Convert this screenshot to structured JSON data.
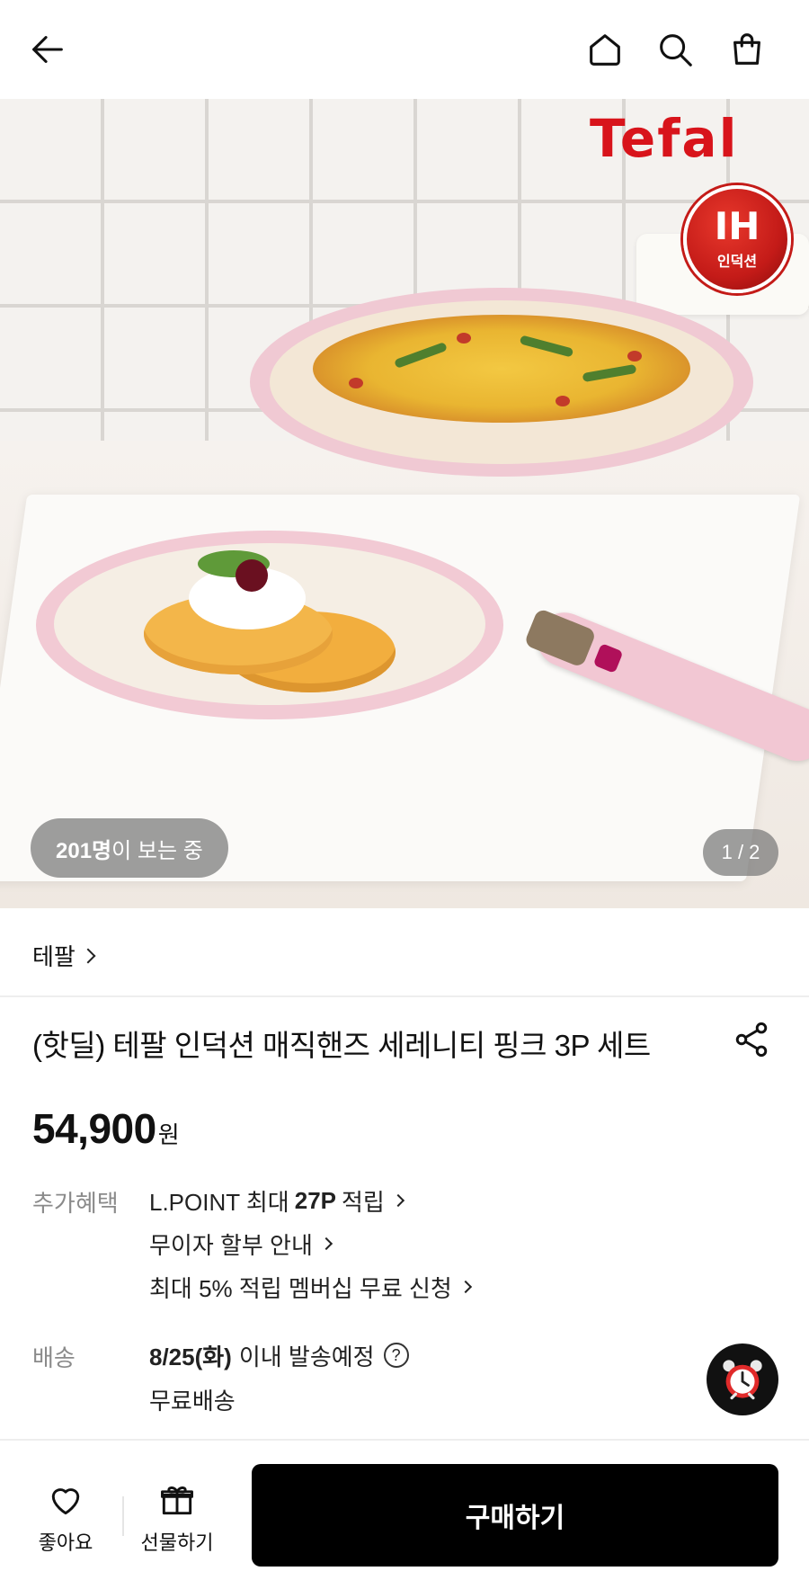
{
  "header": {
    "back_icon": "arrow-left-icon",
    "home_icon": "home-icon",
    "search_icon": "search-icon",
    "cart_icon": "shopping-bag-icon"
  },
  "hero": {
    "logo_text": "Tefal",
    "badge_big": "IH",
    "badge_small": "인덕션",
    "viewers_count": "201명",
    "viewers_suffix": "이 보는 중",
    "page_indicator": "1 / 2",
    "colors": {
      "logo": "#d8141b",
      "pan": "#f0c3cf"
    }
  },
  "product": {
    "brand": "테팔",
    "title": "(핫딜) 테팔 인덕션 매직핸즈 세레니티 핑크 3P 세트",
    "price": "54,900",
    "currency": "원",
    "share_icon": "share-icon"
  },
  "benefits": {
    "label": "추가혜택",
    "point": {
      "prefix": "L.POINT 최대",
      "amount": "27P",
      "suffix": "적립"
    },
    "installment": "무이자 할부 안내",
    "membership": "최대 5% 적립 멤버십 무료 신청"
  },
  "shipping": {
    "label": "배송",
    "date": "8/25(화)",
    "date_suffix": "이내 발송예정",
    "help": "?",
    "fee": "무료배송",
    "alarm_icon": "alarm-clock-icon"
  },
  "bottom_bar": {
    "like_label": "좋아요",
    "gift_label": "선물하기",
    "buy_label": "구매하기",
    "buy_color": "#000000"
  }
}
